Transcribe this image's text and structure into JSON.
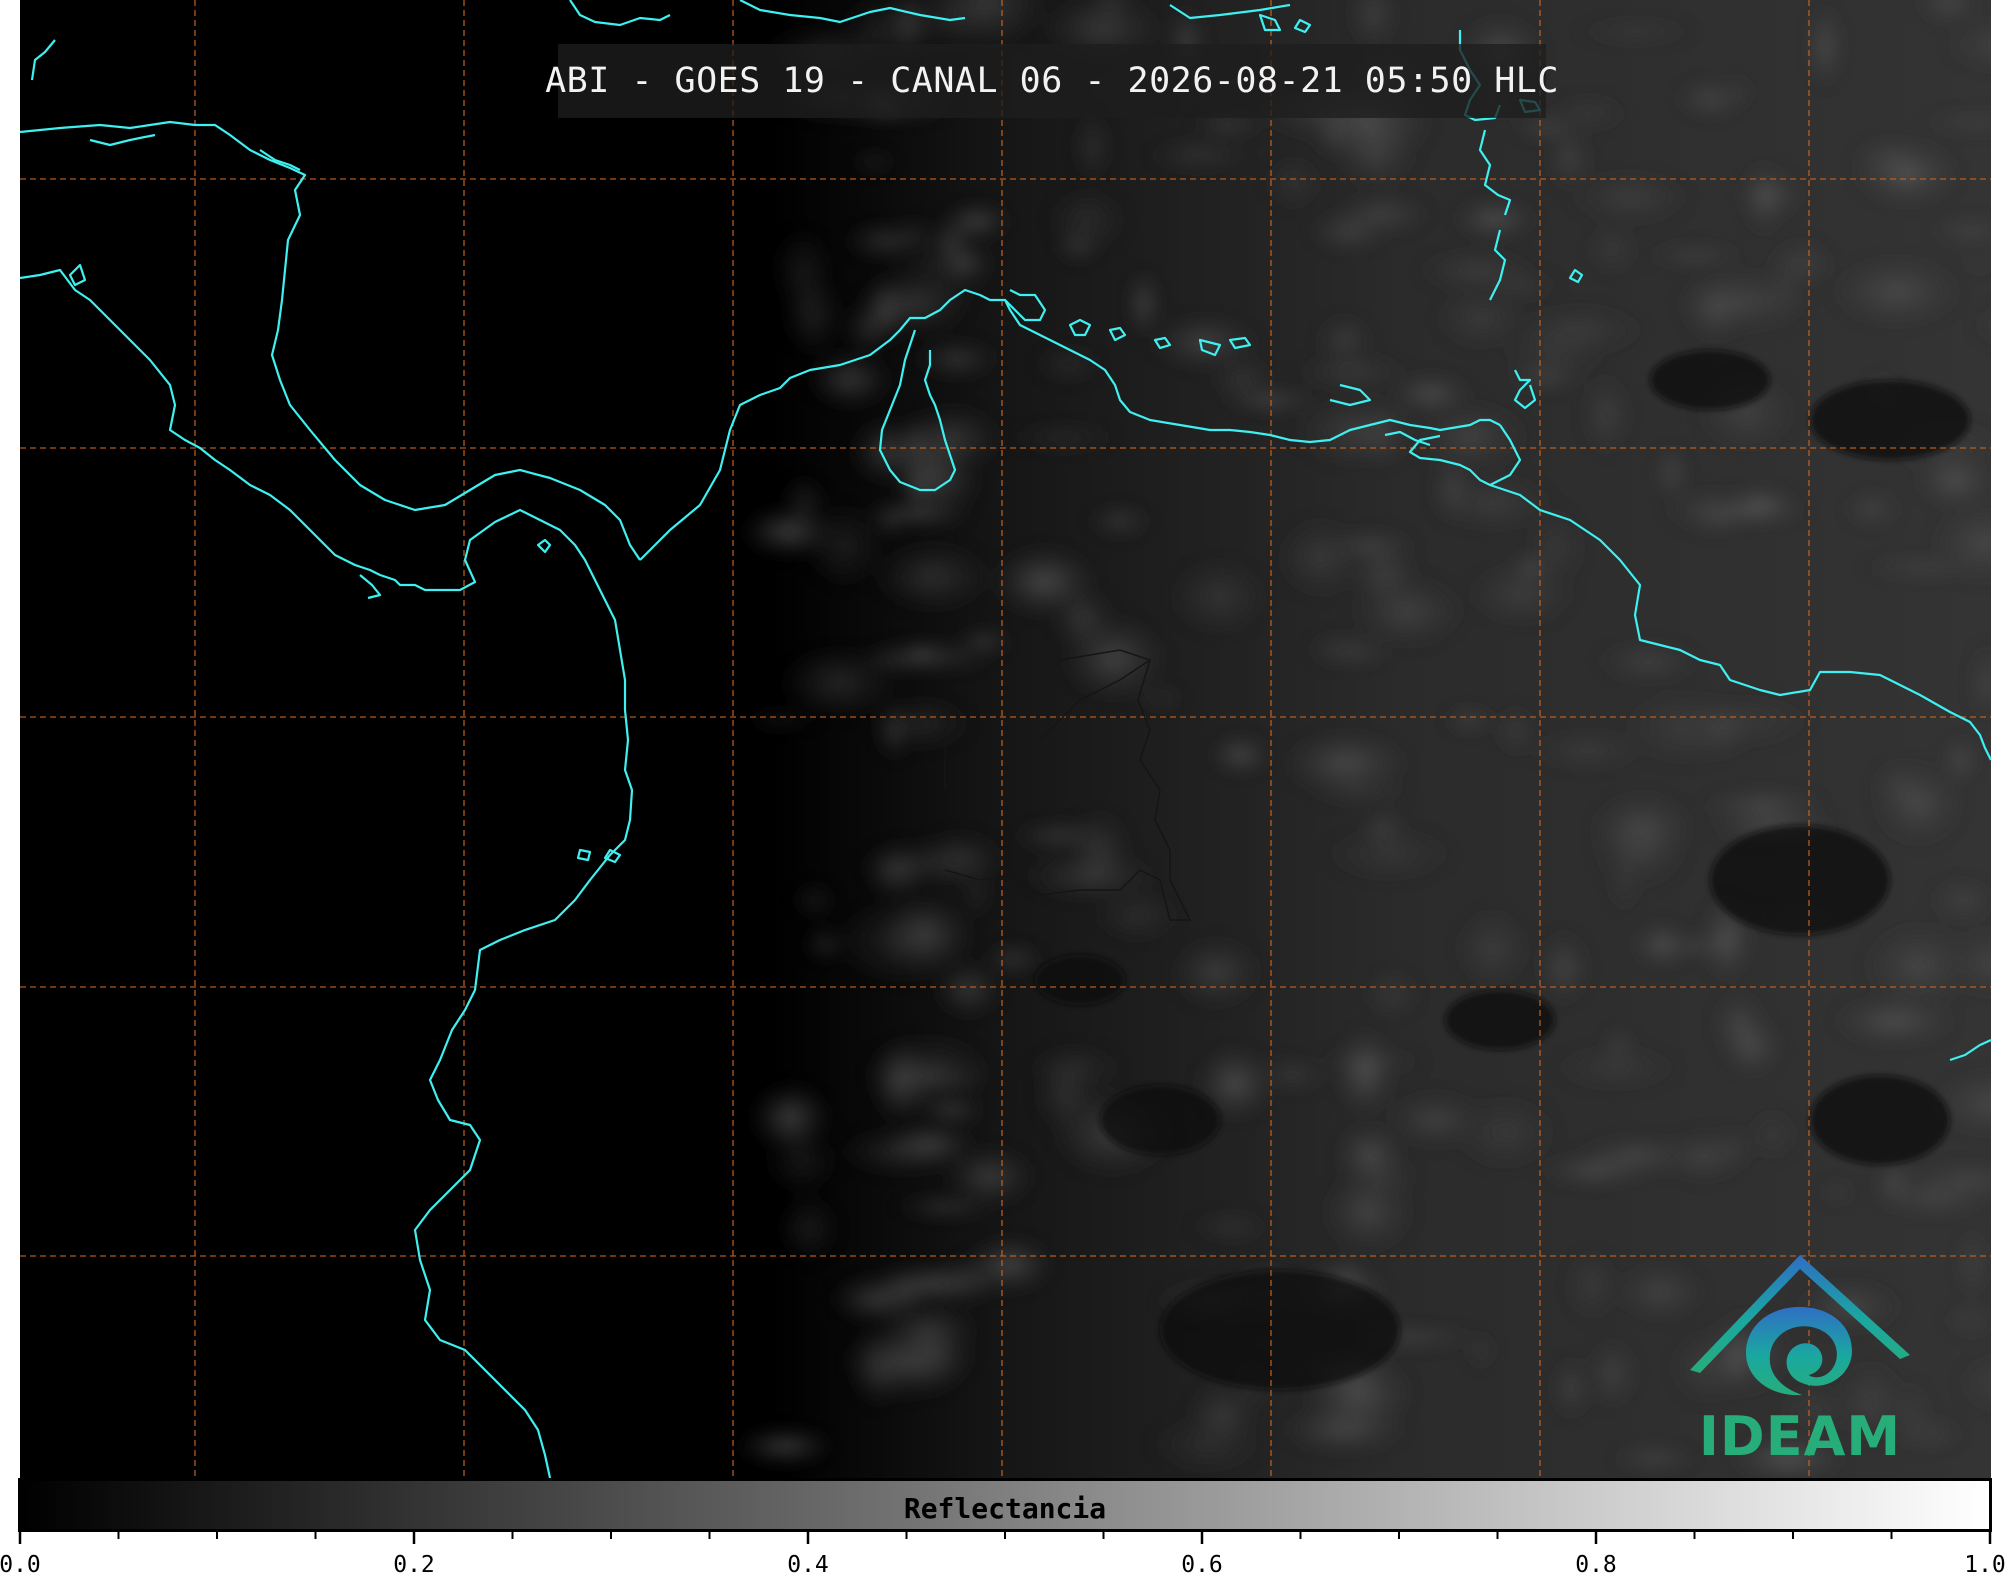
{
  "title": "ABI - GOES 19 - CANAL 06 - 2026-08-21 05:50 HLC",
  "logo": {
    "text": "IDEAM",
    "colors": [
      "#2f6fc4",
      "#1aa7a0",
      "#27ad7a"
    ]
  },
  "colorbar": {
    "label": "Reflectancia",
    "range": [
      0.0,
      1.0
    ],
    "tick_labels": [
      "0.0",
      "0.2",
      "0.4",
      "0.6",
      "0.8",
      "1.0"
    ],
    "minor_step": 0.05,
    "colormap": [
      "#000000",
      "#ffffff"
    ]
  },
  "map": {
    "background": "#000000",
    "coastline_color": "#3ff0f0",
    "border_color": "#1a1a1a",
    "gridline_color": "#c8641e",
    "gridline_style": "dashed"
  }
}
